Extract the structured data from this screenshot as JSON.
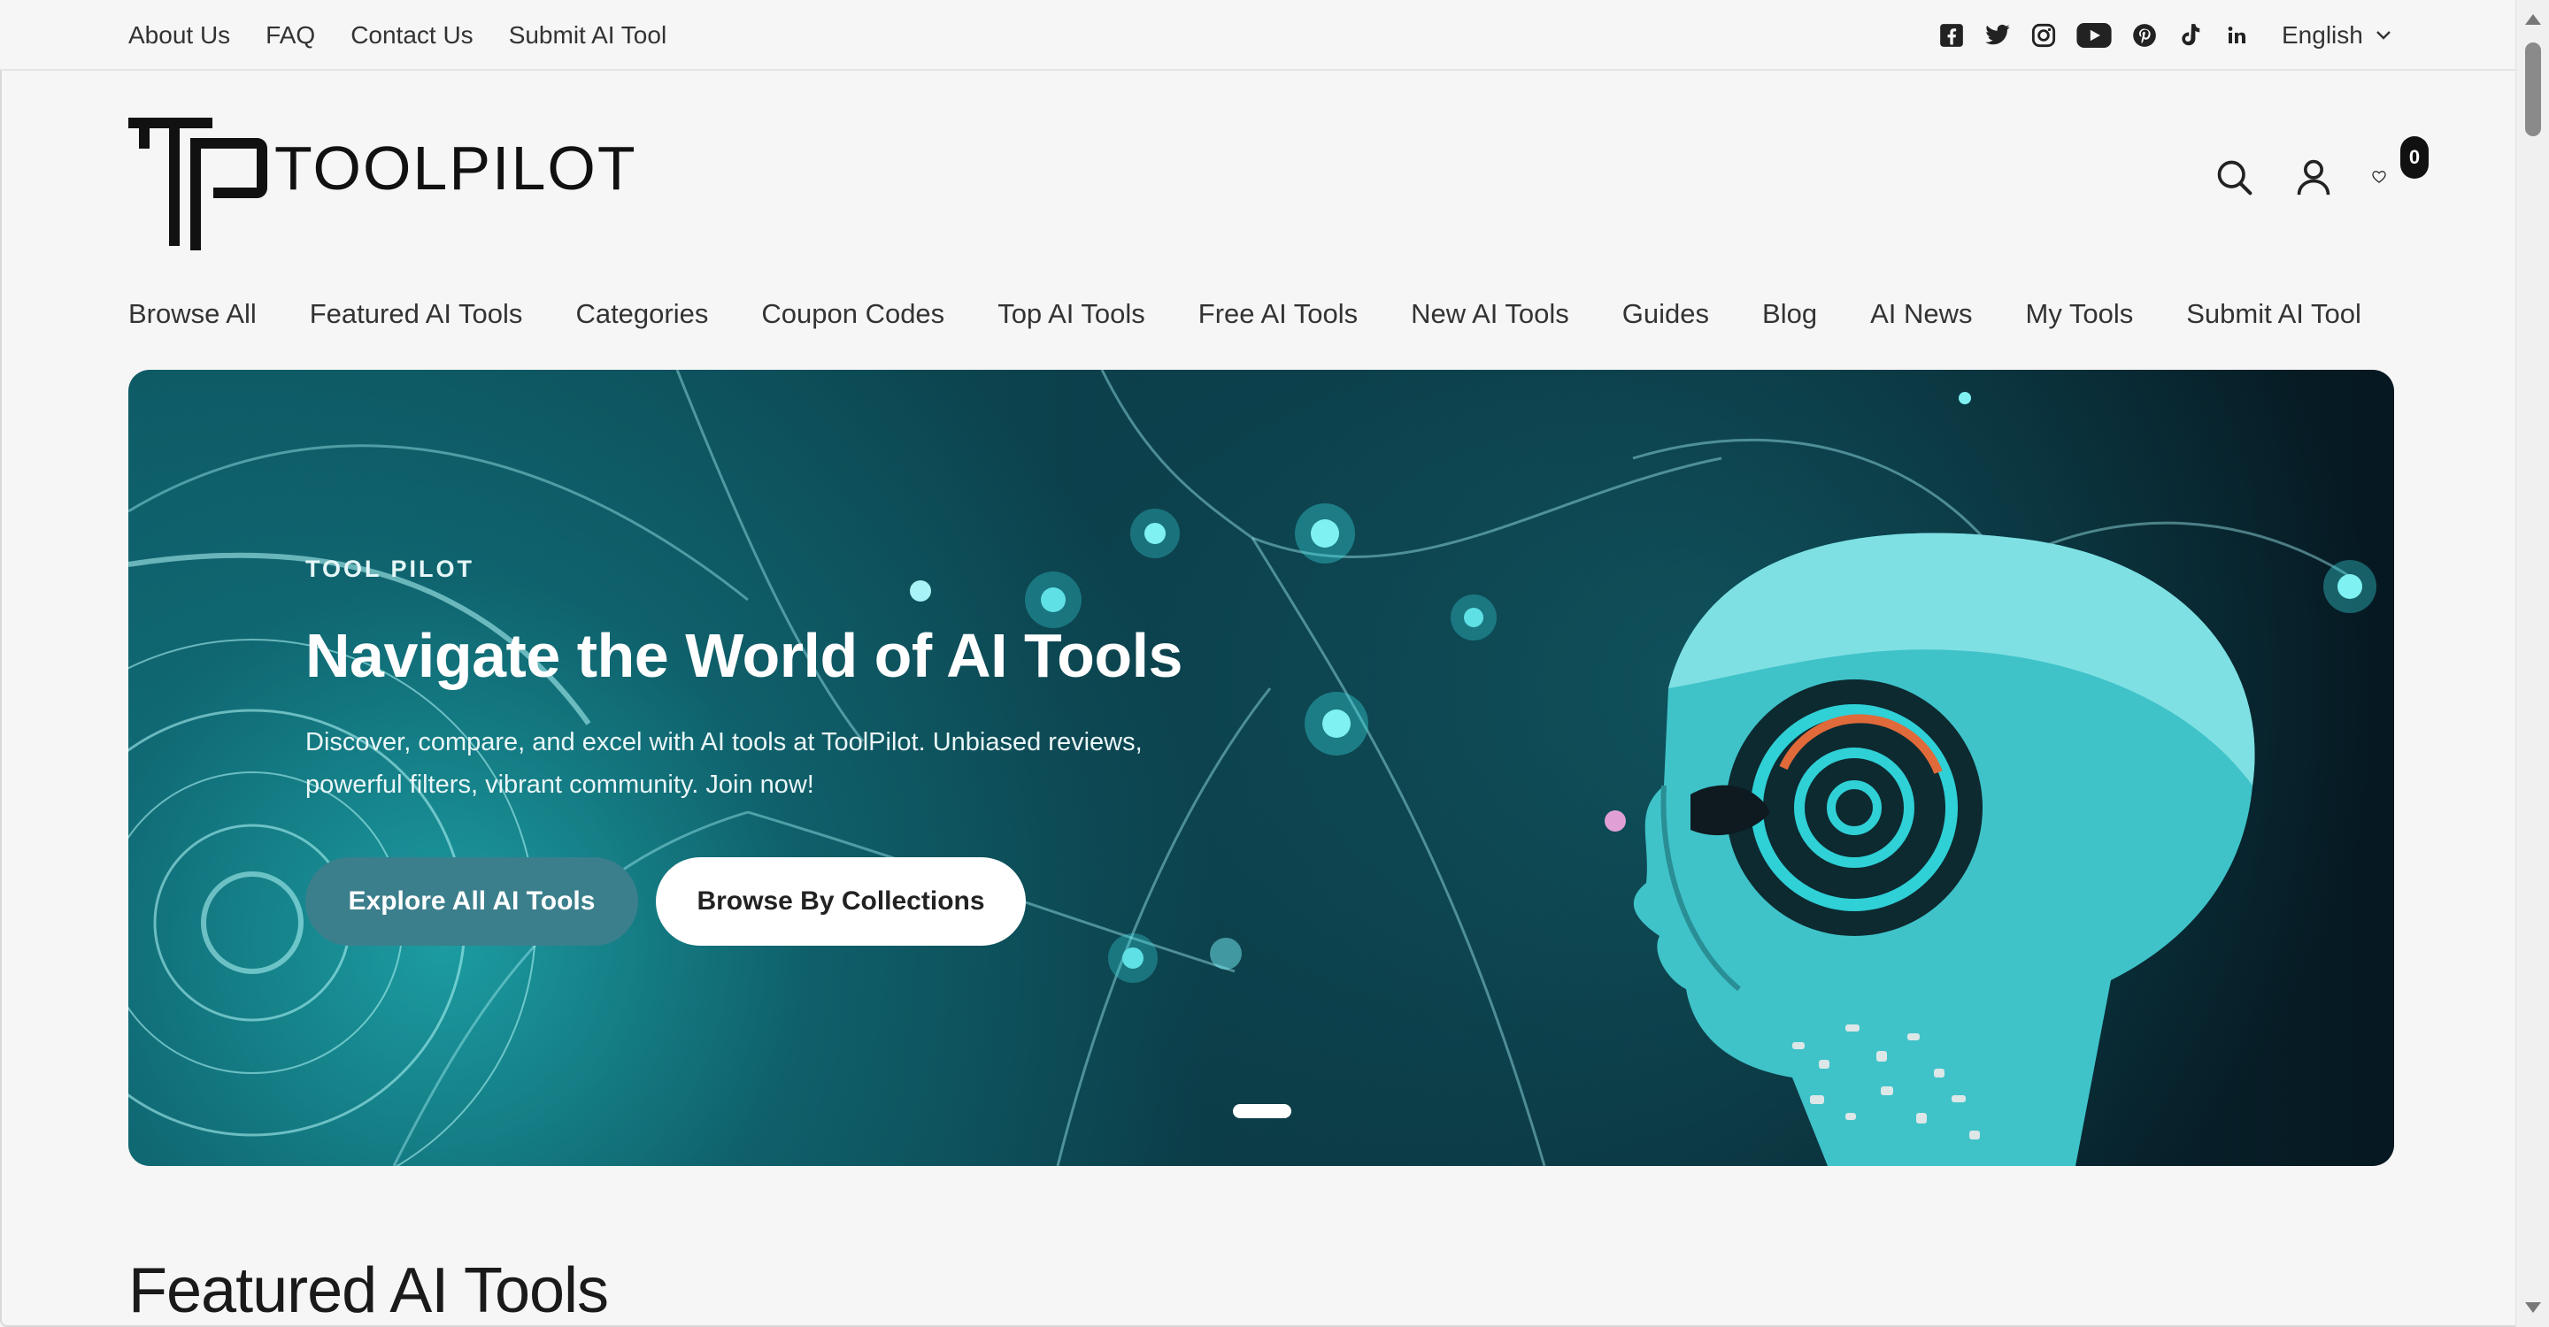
{
  "topbar": {
    "links": [
      "About Us",
      "FAQ",
      "Contact Us",
      "Submit AI Tool"
    ],
    "social_icons": [
      "facebook-icon",
      "twitter-icon",
      "instagram-icon",
      "youtube-icon",
      "pinterest-icon",
      "tiktok-icon",
      "linkedin-icon"
    ],
    "language": "English"
  },
  "header": {
    "logo_text": "TOOLPILOT",
    "icons": [
      "search-icon",
      "account-icon",
      "wishlist-icon"
    ],
    "wishlist_count": "0"
  },
  "nav": {
    "items": [
      "Browse All",
      "Featured AI Tools",
      "Categories",
      "Coupon Codes",
      "Top AI Tools",
      "Free AI Tools",
      "New AI Tools",
      "Guides",
      "Blog",
      "AI News",
      "My Tools",
      "Submit AI Tool"
    ]
  },
  "hero": {
    "eyebrow": "TOOL PILOT",
    "title": "Navigate the World of AI Tools",
    "description": "Discover, compare, and excel with AI tools at ToolPilot. Unbiased reviews, powerful filters, vibrant community. Join now!",
    "primary_button": "Explore All AI Tools",
    "secondary_button": "Browse By Collections",
    "accent_color": "#3b7f8c"
  },
  "featured": {
    "title": "Featured AI Tools"
  }
}
